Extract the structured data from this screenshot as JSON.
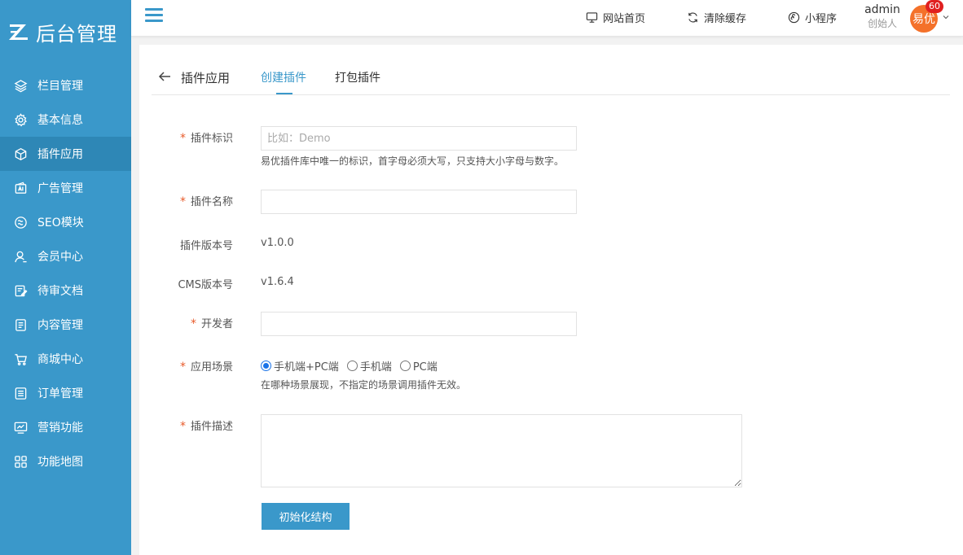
{
  "app": {
    "logo_text": "后台管理",
    "logo_icon": "z-logo-icon"
  },
  "sidebar": {
    "items": [
      {
        "label": "栏目管理",
        "icon": "layers-icon",
        "active": false
      },
      {
        "label": "基本信息",
        "icon": "gear-icon",
        "active": false
      },
      {
        "label": "插件应用",
        "icon": "cube-icon",
        "active": true
      },
      {
        "label": "广告管理",
        "icon": "ad-icon",
        "active": false
      },
      {
        "label": "SEO模块",
        "icon": "seo-icon",
        "active": false
      },
      {
        "label": "会员中心",
        "icon": "user-icon",
        "active": false
      },
      {
        "label": "待审文档",
        "icon": "edit-doc-icon",
        "active": false
      },
      {
        "label": "内容管理",
        "icon": "document-icon",
        "active": false
      },
      {
        "label": "商城中心",
        "icon": "cart-icon",
        "active": false
      },
      {
        "label": "订单管理",
        "icon": "list-icon",
        "active": false
      },
      {
        "label": "营销功能",
        "icon": "chart-monitor-icon",
        "active": false
      },
      {
        "label": "功能地图",
        "icon": "grid-icon",
        "active": false
      }
    ]
  },
  "header": {
    "links": [
      {
        "label": "网站首页",
        "icon": "monitor-icon"
      },
      {
        "label": "清除缓存",
        "icon": "refresh-icon"
      },
      {
        "label": "小程序",
        "icon": "miniprogram-icon"
      }
    ],
    "user": {
      "name": "admin",
      "role": "创始人",
      "avatar_text": "易优",
      "badge": "60"
    }
  },
  "tabs": {
    "title": "插件应用",
    "items": [
      {
        "label": "创建插件",
        "active": true
      },
      {
        "label": "打包插件",
        "active": false
      }
    ]
  },
  "form": {
    "identifier": {
      "label": "插件标识",
      "placeholder": "比如：Demo",
      "value": "",
      "hint": "易优插件库中唯一的标识，首字母必须大写，只支持大小字母与数字。"
    },
    "name": {
      "label": "插件名称",
      "value": ""
    },
    "plugin_version": {
      "label": "插件版本号",
      "value": "v1.0.0"
    },
    "cms_version": {
      "label": "CMS版本号",
      "value": "v1.6.4"
    },
    "developer": {
      "label": "开发者",
      "value": ""
    },
    "scene": {
      "label": "应用场景",
      "options": [
        "手机端+PC端",
        "手机端",
        "PC端"
      ],
      "selected": "手机端+PC端",
      "hint": "在哪种场景展现，不指定的场景调用插件无效。"
    },
    "description": {
      "label": "插件描述",
      "value": ""
    },
    "submit_label": "初始化结构"
  },
  "colors": {
    "primary": "#3a98ca",
    "sidebar_active": "#2e87b6",
    "required": "#e85a2a",
    "avatar": "#f4712a",
    "badge": "#e02020"
  }
}
